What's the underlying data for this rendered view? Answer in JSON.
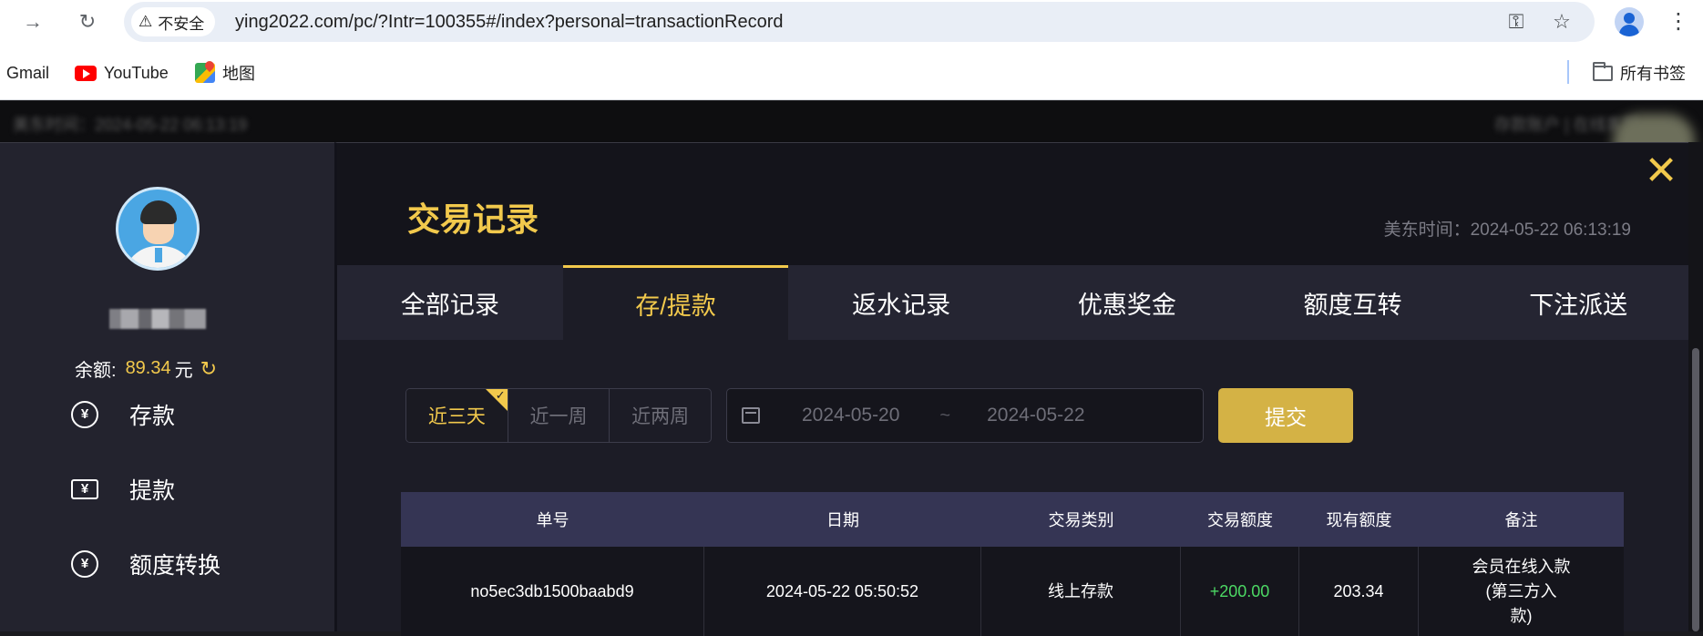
{
  "browser": {
    "back_icon": "arrow-right-icon",
    "reload_icon": "reload-icon",
    "security_label": "不安全",
    "url": "ying2022.com/pc/?Intr=100355#/index?personal=transactionRecord",
    "icons": [
      "key-icon",
      "star-icon",
      "profile-icon",
      "menu-icon"
    ]
  },
  "bookmarks": {
    "items": [
      {
        "label": "Gmail"
      },
      {
        "label": "YouTube"
      },
      {
        "label": "地图"
      }
    ],
    "all_bookmarks": "所有书签"
  },
  "background_page": {
    "left_text": "美东时间：2024-05-22 06:13:19",
    "right_text": "存款账户 | 在线客服"
  },
  "sidebar": {
    "balance_label": "余额:",
    "balance_value": "89.34",
    "balance_unit": "元",
    "items": [
      {
        "label": "存款",
        "icon": "yuan-circle-icon"
      },
      {
        "label": "提款",
        "icon": "ticket-icon"
      },
      {
        "label": "额度转换",
        "icon": "yuan-transfer-icon"
      }
    ]
  },
  "main": {
    "title": "交易记录",
    "time": "美东时间：2024-05-22 06:13:19",
    "tabs": [
      {
        "label": "全部记录",
        "active": false
      },
      {
        "label": "存/提款",
        "active": true
      },
      {
        "label": "返水记录",
        "active": false
      },
      {
        "label": "优惠奖金",
        "active": false
      },
      {
        "label": "额度互转",
        "active": false
      },
      {
        "label": "下注派送",
        "active": false
      }
    ],
    "range_buttons": [
      {
        "label": "近三天",
        "active": true
      },
      {
        "label": "近一周",
        "active": false
      },
      {
        "label": "近两周",
        "active": false
      }
    ],
    "date_start": "2024-05-20",
    "date_sep": "~",
    "date_end": "2024-05-22",
    "submit_label": "提交",
    "table": {
      "headers": [
        "单号",
        "日期",
        "交易类别",
        "交易额度",
        "现有额度",
        "备注"
      ],
      "rows": [
        [
          "no5ec3db1500baabd9",
          "2024-05-22 05:50:52",
          "线上存款",
          "+200.00",
          "203.34",
          "会员在线入款\n(第三方入\n款)"
        ]
      ]
    }
  },
  "colors": {
    "accent": "#f2c94c",
    "submit_bg": "#d4b245",
    "positive": "#4cd964",
    "header_bg": "#353554"
  }
}
